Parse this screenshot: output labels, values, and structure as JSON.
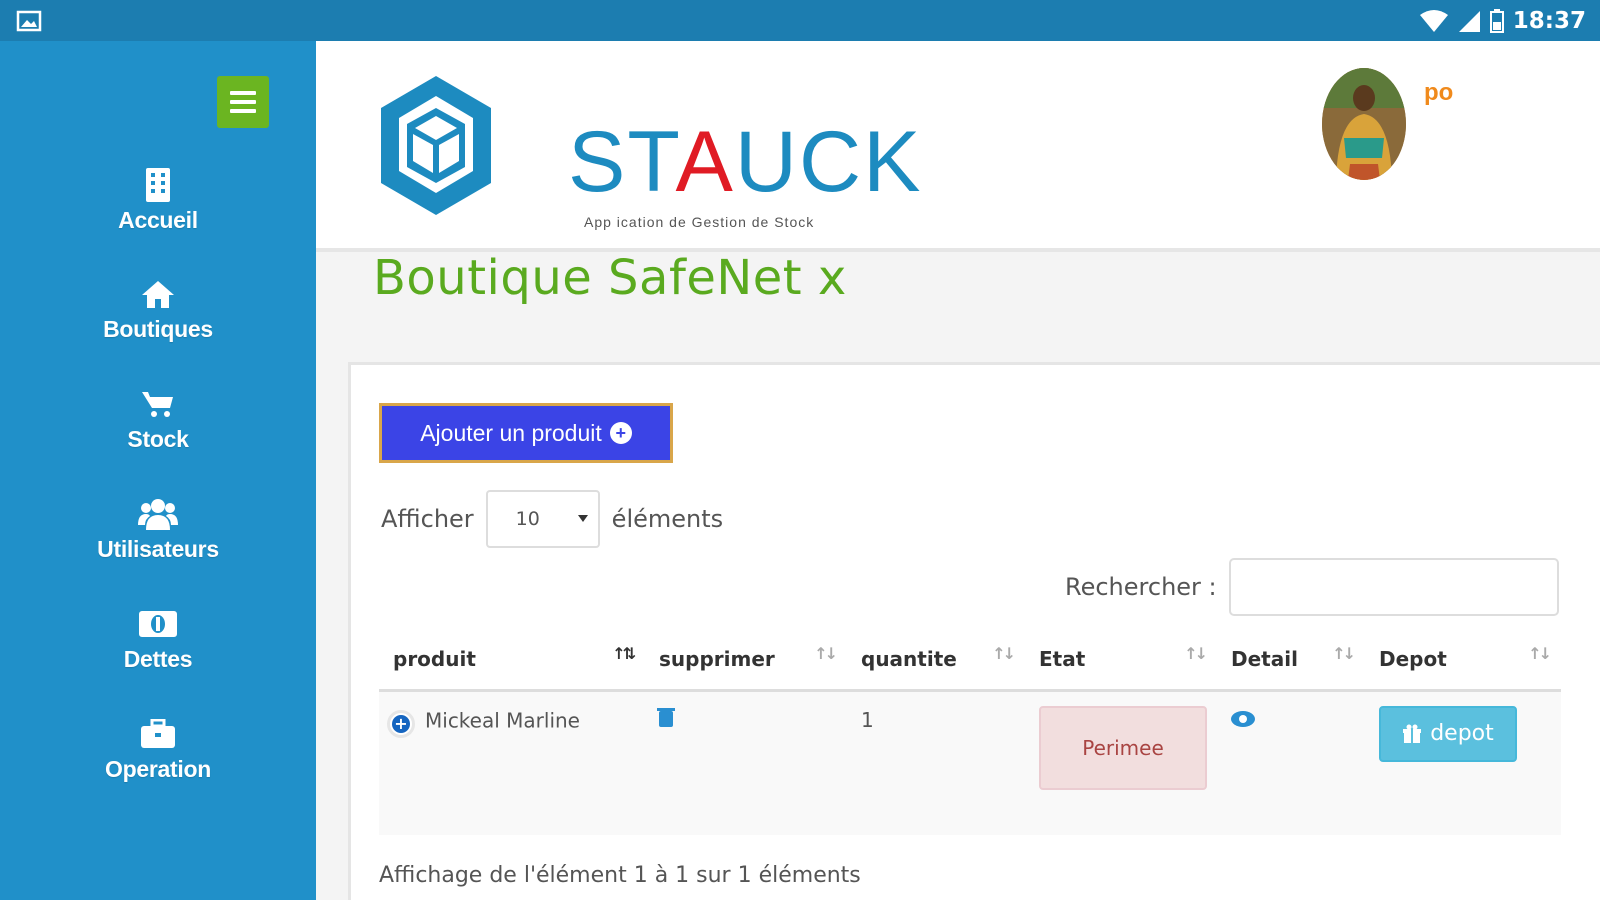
{
  "status_bar": {
    "time": "18:37"
  },
  "sidebar": {
    "items": [
      {
        "label": "Accueil",
        "icon": "building-icon"
      },
      {
        "label": "Boutiques",
        "icon": "home-icon"
      },
      {
        "label": "Stock",
        "icon": "cart-icon"
      },
      {
        "label": "Utilisateurs",
        "icon": "users-icon"
      },
      {
        "label": "Dettes",
        "icon": "money-icon"
      },
      {
        "label": "Operation",
        "icon": "briefcase-icon"
      }
    ]
  },
  "header": {
    "logo_part1": "ST",
    "logo_part2": "A",
    "logo_part3": "UCK",
    "logo_tagline": "App ication de Gestion de Stock",
    "username": "po"
  },
  "page": {
    "title": "Boutique SafeNet x"
  },
  "toolbar": {
    "add_label": "Ajouter un produit"
  },
  "length": {
    "prefix": "Afficher",
    "value": "10",
    "suffix": "éléments"
  },
  "search": {
    "label": "Rechercher :",
    "value": ""
  },
  "table": {
    "columns": [
      "produit",
      "supprimer",
      "quantite",
      "Etat",
      "Detail",
      "Depot"
    ],
    "rows": [
      {
        "produit": "Mickeal Marline",
        "quantite": "1",
        "etat": "Perimee",
        "depot": "depot"
      }
    ]
  },
  "footer": {
    "info": "Affichage de l'élément 1 à 1 sur 1 éléments"
  },
  "colors": {
    "sidebar": "#2090c9",
    "status_bar": "#1c7db0",
    "accent_green": "#5aaa1f",
    "add_button": "#3b44e6",
    "username": "#f08a1c"
  }
}
